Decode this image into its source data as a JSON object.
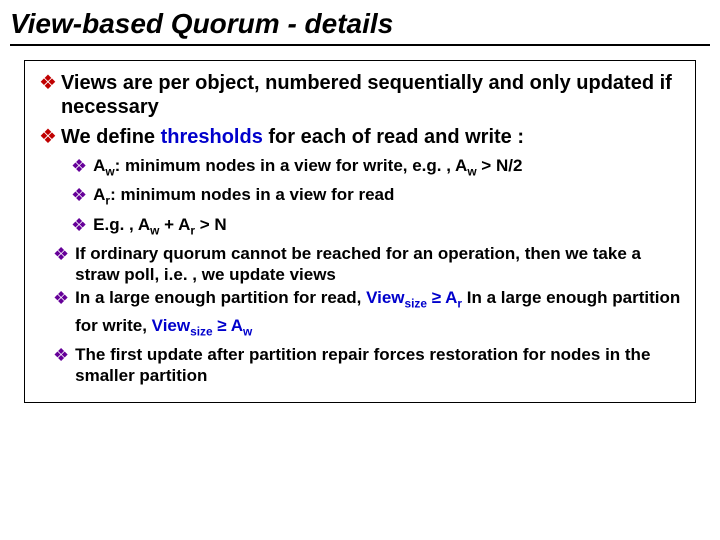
{
  "title": "View-based Quorum - details",
  "l1a": "Views are per object, numbered sequentially and only updated if necessary",
  "l1b_pre": "We define ",
  "l1b_blue": "thresholds",
  "l1b_post": " for each of read and write :",
  "l2a_pre": "A",
  "l2a_sub": "w",
  "l2a_mid": ": minimum nodes in a view for write, e.g. ,  A",
  "l2a_sub2": "w",
  "l2a_end": " > N/2",
  "l2b_pre": "A",
  "l2b_sub": "r",
  "l2b_end": ": minimum nodes in a view for read",
  "l2c_pre": "E.g. ,  A",
  "l2c_sub1": "w",
  "l2c_mid": " + A",
  "l2c_sub2": "r",
  "l2c_end": " > N",
  "l3a": "If ordinary quorum cannot be reached for an operation, then we take a straw poll, i.e. , we update views",
  "l3b_pre": "In a large enough partition for read, ",
  "l3b_v1": "View",
  "l3b_vs1": "size",
  "l3b_ge1": " ≥ A",
  "l3b_ar": "r",
  "l3b_mid": "    In a large enough partition for write, ",
  "l3b_v2": "View",
  "l3b_vs2": "size",
  "l3b_ge2": " ≥ A",
  "l3b_aw": "w",
  "l3c": "The first update after partition repair forces restoration for nodes in the smaller partition",
  "diamond": "❖"
}
